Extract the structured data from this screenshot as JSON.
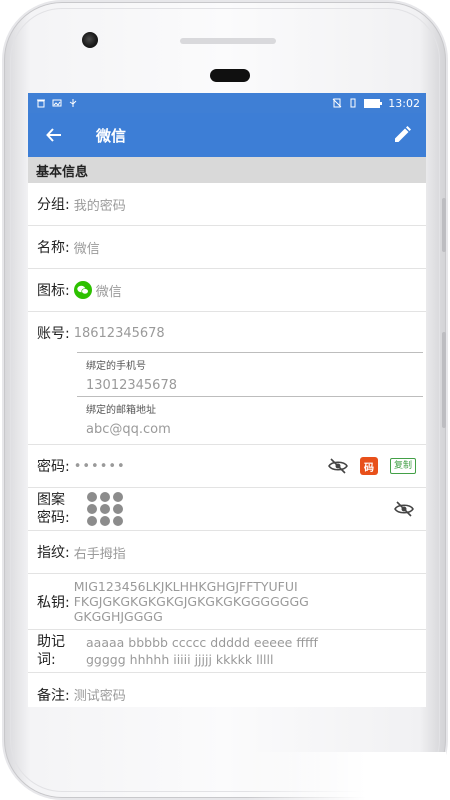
{
  "status_bar": {
    "time": "13:02"
  },
  "app_bar": {
    "title": "微信"
  },
  "section": {
    "title": "基本信息"
  },
  "fields": {
    "group": {
      "label": "分组:",
      "value": "我的密码"
    },
    "name": {
      "label": "名称:",
      "value": "微信"
    },
    "icon": {
      "label": "图标:",
      "value": "微信"
    },
    "account": {
      "label": "账号:",
      "value": "18612345678",
      "phone_label": "绑定的手机号",
      "phone_value": "13012345678",
      "email_label": "绑定的邮箱地址",
      "email_value": "abc@qq.com"
    },
    "password": {
      "label": "密码:",
      "value": "••••••",
      "generator_tag": "码",
      "copy_label": "复制"
    },
    "pattern": {
      "label": "图案密码:",
      "label_line1": "图案",
      "label_line2": "密码:"
    },
    "fingerprint": {
      "label": "指纹:",
      "value": "右手拇指"
    },
    "private_key": {
      "label": "私钥:",
      "line1": "MIG123456LKJKLHHKGHGJFFTYUFUI",
      "line2": "FKGJGKGKGKGKGJGKGKGKGGGGGGG",
      "line3": "GKGGHJGGGG"
    },
    "mnemonic": {
      "label_line1": "助记",
      "label_line2": "词:",
      "line1": "aaaaa bbbbb ccccc ddddd eeeee fffff",
      "line2": "ggggg hhhhh iiiii jjjjj kkkkk lllll"
    },
    "note": {
      "label": "备注:",
      "value": "测试密码"
    }
  },
  "colors": {
    "primary": "#3d7ed6",
    "wechat_green": "#2dc100",
    "copy_green": "#43a047",
    "tag_orange": "#e8501a"
  },
  "icons": {
    "back": "arrow-left-icon",
    "edit": "pencil-icon",
    "visibility": "eye-off-icon"
  }
}
